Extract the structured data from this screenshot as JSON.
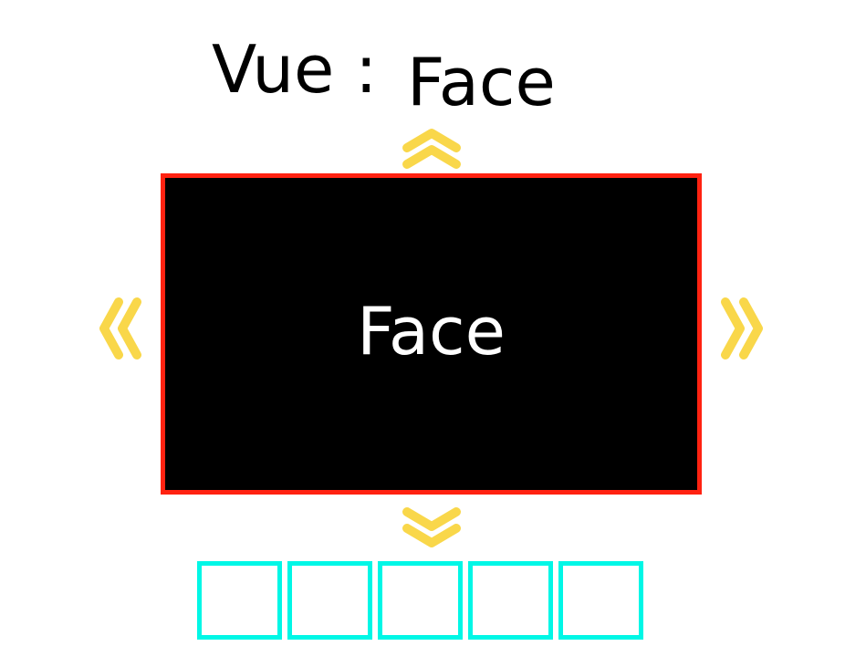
{
  "header": {
    "prefix": "Vue :",
    "current_view": "Face"
  },
  "panel": {
    "label": "Face"
  },
  "navigation": {
    "up_icon": "double-chevron-up-icon",
    "down_icon": "double-chevron-down-icon",
    "left_icon": "double-chevron-left-icon",
    "right_icon": "double-chevron-right-icon"
  },
  "slots": {
    "count": 5
  },
  "colors": {
    "chevron": "#f9d74a",
    "panel_border": "#ff2211",
    "panel_fill": "#000000",
    "slot_border": "#00f7e6"
  }
}
